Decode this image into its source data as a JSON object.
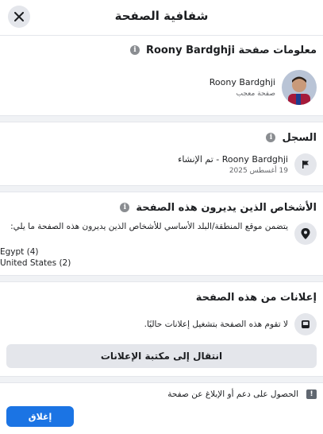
{
  "header": {
    "title": "شفافية الصفحة"
  },
  "page_info": {
    "title": "معلومات صفحة Roony Bardghji",
    "page_name": "Roony Bardghji",
    "page_type": "صفحة معجب"
  },
  "history": {
    "title": "السجل",
    "event": "Roony Bardghji - تم الإنشاء",
    "date": "19 أغسطس 2025"
  },
  "managers": {
    "title": "الأشخاص الذين يديرون هذه الصفحة",
    "description": "يتضمن موقع المنطقة/البلد الأساسي للأشخاص الذين يديرون هذه الصفحة ما يلي:",
    "countries": [
      "Egypt (4)",
      "United States (2)"
    ]
  },
  "ads": {
    "title": "إعلانات من هذه الصفحة",
    "status": "لا تقوم هذه الصفحة بتشغيل إعلانات حاليًا.",
    "library_button": "انتقال إلى مكتبة الإعلانات"
  },
  "footer": {
    "report_link": "الحصول على دعم أو الإبلاغ عن صفحة",
    "close_button": "إغلاق"
  },
  "colors": {
    "primary": "#1b74e4",
    "secondary_bg": "#e4e6eb",
    "divider": "#f0f2f5",
    "muted_text": "#65676b"
  },
  "icons": [
    "close-icon",
    "info-icon",
    "flag-icon",
    "location-pin-icon",
    "ad-card-icon",
    "report-icon"
  ]
}
